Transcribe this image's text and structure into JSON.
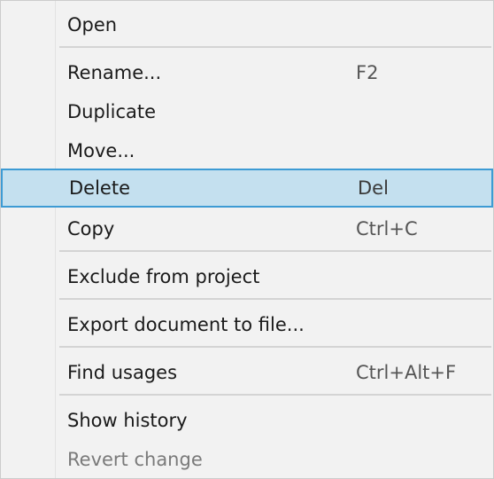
{
  "menu": {
    "items": [
      {
        "label": "Open",
        "shortcut": ""
      },
      {
        "label": "Rename...",
        "shortcut": "F2"
      },
      {
        "label": "Duplicate",
        "shortcut": ""
      },
      {
        "label": "Move...",
        "shortcut": ""
      },
      {
        "label": "Delete",
        "shortcut": "Del",
        "state": "highlighted"
      },
      {
        "label": "Copy",
        "shortcut": "Ctrl+C"
      },
      {
        "label": "Exclude from project",
        "shortcut": ""
      },
      {
        "label": "Export document to file...",
        "shortcut": ""
      },
      {
        "label": "Find usages",
        "shortcut": "Ctrl+Alt+F"
      },
      {
        "label": "Show history",
        "shortcut": ""
      },
      {
        "label": "Revert change",
        "shortcut": "",
        "state": "disabled"
      }
    ]
  },
  "colors": {
    "highlight_fill": "#c4e0ef",
    "highlight_border": "#3d9bd4",
    "disabled_text": "#7a7a7a"
  }
}
